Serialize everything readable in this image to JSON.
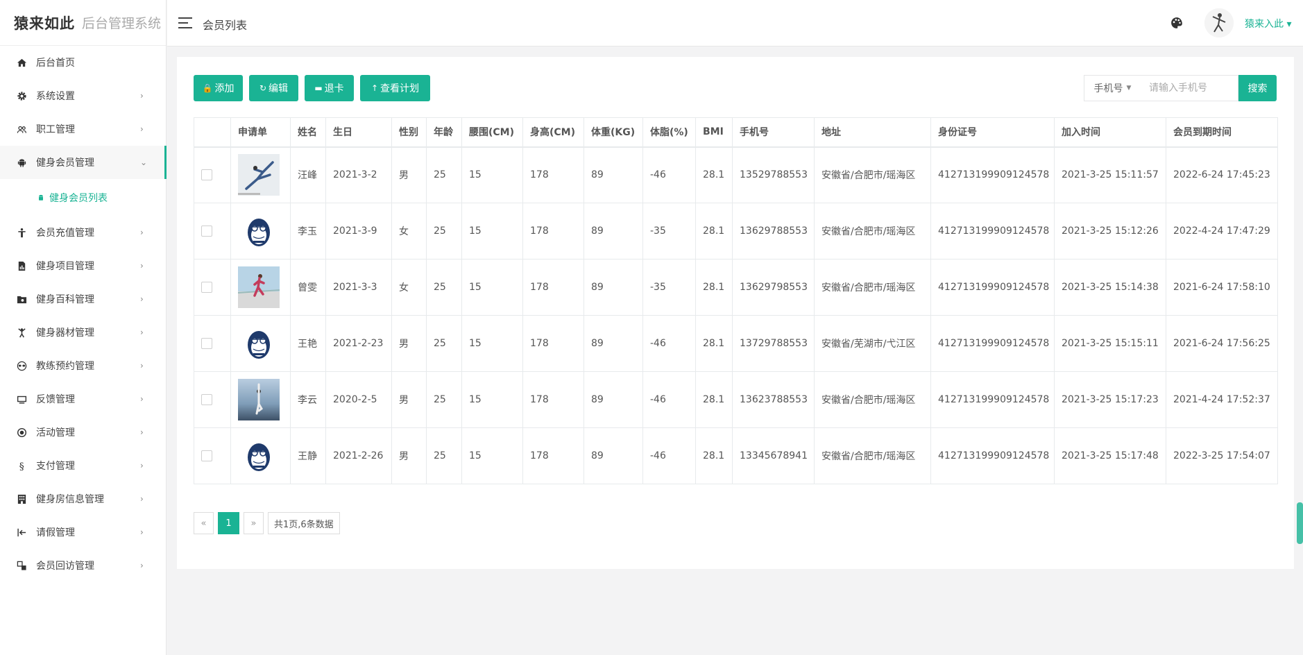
{
  "brand": {
    "logo": "猿来如此",
    "system_name": "后台管理系统"
  },
  "sidebar": {
    "items": [
      {
        "label": "后台首页",
        "icon": "home-icon",
        "arrow": ""
      },
      {
        "label": "系统设置",
        "icon": "gear-icon",
        "arrow": "›"
      },
      {
        "label": "职工管理",
        "icon": "users-icon",
        "arrow": "›"
      },
      {
        "label": "健身会员管理",
        "icon": "android-icon",
        "arrow": "⌄"
      },
      {
        "label": "会员充值管理",
        "icon": "person-icon",
        "arrow": "›"
      },
      {
        "label": "健身项目管理",
        "icon": "document-chart-icon",
        "arrow": "›"
      },
      {
        "label": "健身百科管理",
        "icon": "folder-icon",
        "arrow": "›"
      },
      {
        "label": "健身器材管理",
        "icon": "fitness-person-icon",
        "arrow": "›"
      },
      {
        "label": "教练预约管理",
        "icon": "goggles-icon",
        "arrow": "›"
      },
      {
        "label": "反馈管理",
        "icon": "monitor-icon",
        "arrow": "›"
      },
      {
        "label": "活动管理",
        "icon": "target-icon",
        "arrow": "›"
      },
      {
        "label": "支付管理",
        "icon": "section-icon",
        "arrow": "›"
      },
      {
        "label": "健身房信息管理",
        "icon": "building-icon",
        "arrow": "›"
      },
      {
        "label": "请假管理",
        "icon": "arrow-left-bar-icon",
        "arrow": "›"
      },
      {
        "label": "会员回访管理",
        "icon": "clone-icon",
        "arrow": "›"
      }
    ],
    "submenu": {
      "label": "健身会员列表",
      "icon": "android-small-icon"
    }
  },
  "header": {
    "title": "会员列表",
    "username": "猿来入此 ▾"
  },
  "toolbar": {
    "add": "添加",
    "edit": "编辑",
    "withdraw": "退卡",
    "view_plan": "查看计划"
  },
  "search": {
    "select_value": "手机号",
    "placeholder": "请输入手机号",
    "button": "搜索"
  },
  "table": {
    "columns": [
      "",
      "申请单",
      "姓名",
      "生日",
      "性别",
      "年龄",
      "腰围(CM)",
      "身高(CM)",
      "体重(KG)",
      "体脂(%)",
      "BMI",
      "手机号",
      "地址",
      "身份证号",
      "加入时间",
      "会员到期时间"
    ],
    "rows": [
      {
        "image": "dancer-photo",
        "name": "汪峰",
        "birthday": "2021-3-2",
        "gender": "男",
        "age": "25",
        "waist": "15",
        "height": "178",
        "weight": "89",
        "fat": "-46",
        "bmi": "28.1",
        "phone": "13529788553",
        "address": "安徽省/合肥市/瑶海区",
        "id_card": "412713199909124578",
        "join_time": "2021-3-25 15:11:57",
        "expire_time": "2022-6-24 17:45:23"
      },
      {
        "image": "monkey-logo",
        "name": "李玉",
        "birthday": "2021-3-9",
        "gender": "女",
        "age": "25",
        "waist": "15",
        "height": "178",
        "weight": "89",
        "fat": "-35",
        "bmi": "28.1",
        "phone": "13629788553",
        "address": "安徽省/合肥市/瑶海区",
        "id_card": "412713199909124578",
        "join_time": "2021-3-25 15:12:26",
        "expire_time": "2022-4-24 17:47:29"
      },
      {
        "image": "runner-photo",
        "name": "曾雯",
        "birthday": "2021-3-3",
        "gender": "女",
        "age": "25",
        "waist": "15",
        "height": "178",
        "weight": "89",
        "fat": "-35",
        "bmi": "28.1",
        "phone": "13629798553",
        "address": "安徽省/合肥市/瑶海区",
        "id_card": "412713199909124578",
        "join_time": "2021-3-25 15:14:38",
        "expire_time": "2021-6-24 17:58:10"
      },
      {
        "image": "monkey-logo",
        "name": "王艳",
        "birthday": "2021-2-23",
        "gender": "男",
        "age": "25",
        "waist": "15",
        "height": "178",
        "weight": "89",
        "fat": "-46",
        "bmi": "28.1",
        "phone": "13729788553",
        "address": "安徽省/芜湖市/弋江区",
        "id_card": "412713199909124578",
        "join_time": "2021-3-25 15:15:11",
        "expire_time": "2021-6-24 17:56:25"
      },
      {
        "image": "yoga-photo",
        "name": "李云",
        "birthday": "2020-2-5",
        "gender": "男",
        "age": "25",
        "waist": "15",
        "height": "178",
        "weight": "89",
        "fat": "-46",
        "bmi": "28.1",
        "phone": "13623788553",
        "address": "安徽省/合肥市/瑶海区",
        "id_card": "412713199909124578",
        "join_time": "2021-3-25 15:17:23",
        "expire_time": "2021-4-24 17:52:37"
      },
      {
        "image": "monkey-logo",
        "name": "王静",
        "birthday": "2021-2-26",
        "gender": "男",
        "age": "25",
        "waist": "15",
        "height": "178",
        "weight": "89",
        "fat": "-46",
        "bmi": "28.1",
        "phone": "13345678941",
        "address": "安徽省/合肥市/瑶海区",
        "id_card": "412713199909124578",
        "join_time": "2021-3-25 15:17:48",
        "expire_time": "2022-3-25 17:54:07"
      }
    ]
  },
  "pagination": {
    "prev": "«",
    "current": "1",
    "next": "»",
    "info": "共1页,6条数据"
  },
  "colors": {
    "accent": "#1ab394",
    "female": "#4a90d9"
  }
}
